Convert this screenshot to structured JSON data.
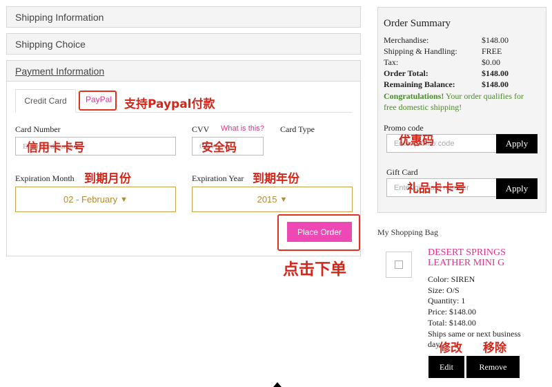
{
  "sections": {
    "shipping_info": "Shipping Information",
    "shipping_choice": "Shipping Choice",
    "payment_info": "Payment Information"
  },
  "payment": {
    "tabs": {
      "credit_card": "Credit Card",
      "paypal": "PayPal"
    },
    "card_number_label": "Card Number",
    "card_number_placeholder": "Enter card number",
    "cvv_label": "CVV",
    "cvv_placeholder": "CVV",
    "whats_this": "What is this?",
    "card_type_label": "Card Type",
    "exp_month_label": "Expiration Month",
    "exp_month_value": "02 - February",
    "exp_year_label": "Expiration Year",
    "exp_year_value": "2015",
    "place_order": "Place Order"
  },
  "summary": {
    "title": "Order Summary",
    "merch_label": "Merchandise:",
    "merch_value": "$148.00",
    "ship_label": "Shipping & Handling:",
    "ship_value": "FREE",
    "tax_label": "Tax:",
    "tax_value": "$0.00",
    "total_label": "Order Total:",
    "total_value": "$148.00",
    "balance_label": "Remaining Balance:",
    "balance_value": "$148.00",
    "congrats_bold": "Congratulations!",
    "congrats_line1": " Your order qualifies for",
    "congrats_line2": "free domestic shipping!",
    "promo_label": "Promo code",
    "promo_placeholder": "Enter promo code",
    "gift_label": "Gift Card",
    "gift_placeholder": "Enter gift card number",
    "apply": "Apply"
  },
  "bag": {
    "title": "My Shopping Bag",
    "item_name_1": "DESERT SPRINGS",
    "item_name_2": "LEATHER MINI G",
    "color": "Color: SIREN",
    "size": "Size: O/S",
    "quantity": "Quantity: 1",
    "price": "Price: $148.00",
    "total": "Total: $148.00",
    "ships_1": "Ships same or next business",
    "ships_2": "day",
    "edit": "Edit",
    "remove": "Remove"
  },
  "annotations": {
    "paypal": "支持Paypal付款",
    "card_number": "信用卡卡号",
    "cvv": "安全码",
    "exp_month": "到期月份",
    "exp_year": "到期年份",
    "place_order": "点击下单",
    "promo": "优惠码",
    "gift": "礼品卡卡号",
    "edit": "修改",
    "remove": "移除"
  },
  "colors": {
    "accent_pink": "#e0308f",
    "gold": "#c8a24a",
    "annotation_red": "#d3261a",
    "congrats_green": "#4a8a2a"
  }
}
